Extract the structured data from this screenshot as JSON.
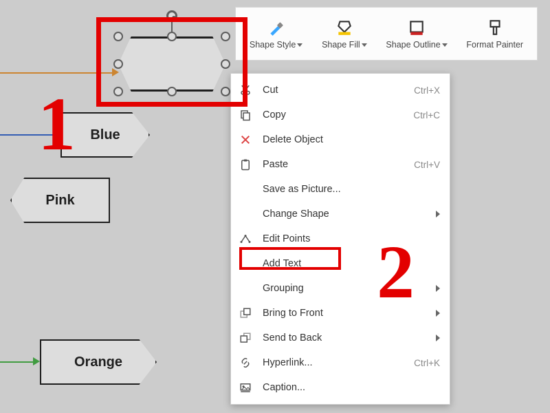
{
  "toolbar": {
    "shape_style": "Shape Style",
    "shape_fill": "Shape Fill",
    "shape_outline": "Shape Outline",
    "format_painter": "Format Painter"
  },
  "shapes": {
    "blue": "Blue",
    "pink": "Pink",
    "orange": "Orange"
  },
  "annotations": {
    "step1": "1",
    "step2": "2"
  },
  "context_menu": [
    {
      "icon": "cut-icon",
      "label": "Cut",
      "shortcut": "Ctrl+X"
    },
    {
      "icon": "copy-icon",
      "label": "Copy",
      "shortcut": "Ctrl+C"
    },
    {
      "icon": "delete-icon",
      "label": "Delete Object",
      "shortcut": ""
    },
    {
      "icon": "paste-icon",
      "label": "Paste",
      "shortcut": "Ctrl+V"
    },
    {
      "icon": "",
      "label": "Save as Picture...",
      "shortcut": ""
    },
    {
      "icon": "",
      "label": "Change Shape",
      "submenu": true
    },
    {
      "icon": "editpoints-icon",
      "label": "Edit Points",
      "shortcut": ""
    },
    {
      "icon": "",
      "label": "Add Text",
      "shortcut": ""
    },
    {
      "icon": "",
      "label": "Grouping",
      "submenu": true
    },
    {
      "icon": "bringfront-icon",
      "label": "Bring to Front",
      "submenu": true
    },
    {
      "icon": "sendback-icon",
      "label": "Send to Back",
      "submenu": true
    },
    {
      "icon": "hyperlink-icon",
      "label": "Hyperlink...",
      "shortcut": "Ctrl+K"
    },
    {
      "icon": "caption-icon",
      "label": "Caption...",
      "shortcut": ""
    }
  ]
}
